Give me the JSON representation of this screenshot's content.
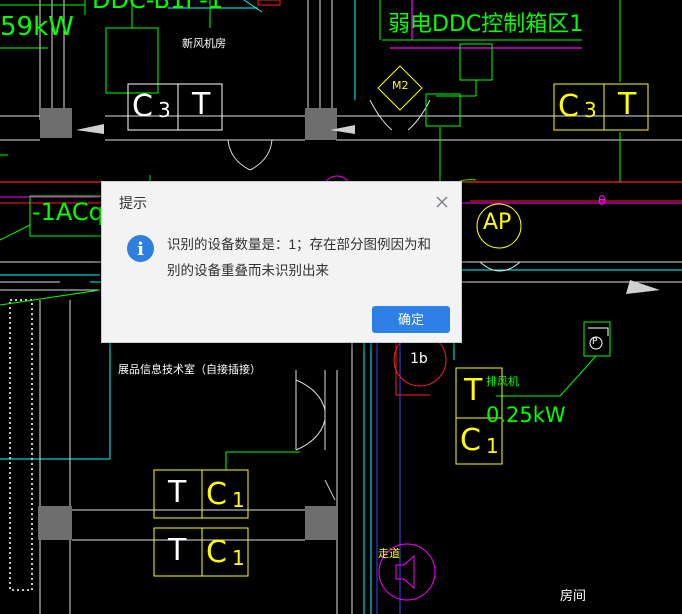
{
  "drawing": {
    "power_top_left": "59kW",
    "ddc_top": "DDC-B1F-1",
    "room_fresh_air": "新风机房",
    "ddc_zone": "弱电DDC控制箱区1",
    "motor_tag": "M2",
    "ac_tag": "-1ACq",
    "ap_tag": "AP",
    "room_label": "展品信息技术室（自接插接）",
    "exhaust_fan": "排风机",
    "exhaust_power": "0.25kW",
    "aisle": "走道",
    "room_corner": "房间",
    "sensor_1b": "1b",
    "p_symbol": "P",
    "box_left_top": {
      "a": "C",
      "b": "3",
      "c": "T"
    },
    "box_right_top": {
      "a": "C",
      "b": "3",
      "c": "T"
    },
    "box_t1": "T",
    "box_c1": {
      "a": "C",
      "b": "1"
    },
    "box_bottom_1": {
      "t": "T",
      "a": "C",
      "b": "1"
    },
    "box_bottom_2": {
      "t": "T",
      "a": "C",
      "b": "1"
    },
    "theta": "θ"
  },
  "dialog": {
    "title": "提示",
    "message": "识别的设备数量是：1；存在部分图例因为和别的设备重叠而未识别出来",
    "ok_label": "确定",
    "icon": "info-icon",
    "accent_color": "#2f80e6"
  }
}
